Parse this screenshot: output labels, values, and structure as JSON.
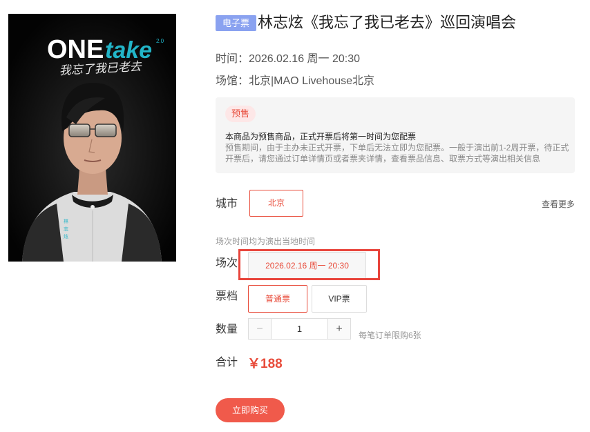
{
  "poster": {
    "brand": "ONE",
    "brand_script": "take",
    "brand_version": "2.0",
    "handwritten_subtitle": "我忘了我已老去",
    "vertical_name": [
      "林",
      "志",
      "炫"
    ]
  },
  "event": {
    "ticket_type_badge": "电子票",
    "title": "林志炫《我忘了我已老去》巡回演唱会",
    "time_label": "时间：",
    "time_value": "2026.02.16 周一 20:30",
    "venue_label": "场馆：",
    "venue_value": "北京|MAO Livehouse北京"
  },
  "notice": {
    "tag": "预售",
    "headline": "本商品为预售商品，正式开票后将第一时间为您配票",
    "body": "预售期间，由于主办未正式开票，下单后无法立即为您配票。一般于演出前1-2周开票，待正式开票后，请您通过订单详情页或者票夹详情，查看票品信息、取票方式等演出相关信息"
  },
  "city": {
    "label": "城市",
    "options": [
      "北京"
    ],
    "selected": "北京",
    "see_more": "查看更多"
  },
  "session": {
    "note": "场次时间均为演出当地时间",
    "label": "场次",
    "options": [
      "2026.02.16 周一 20:30"
    ]
  },
  "tier": {
    "label": "票档",
    "options": [
      "普通票",
      "VIP票"
    ],
    "selected": "普通票"
  },
  "quantity": {
    "label": "数量",
    "minus": "−",
    "value": "1",
    "plus": "+",
    "limit_note": "每笔订单限购6张"
  },
  "total": {
    "label": "合计",
    "price": "￥188"
  },
  "buy_button": "立即购买",
  "colors": {
    "accent": "#e84b3a",
    "badge": "#8aa2f0",
    "highlight_frame": "#e8453c"
  }
}
